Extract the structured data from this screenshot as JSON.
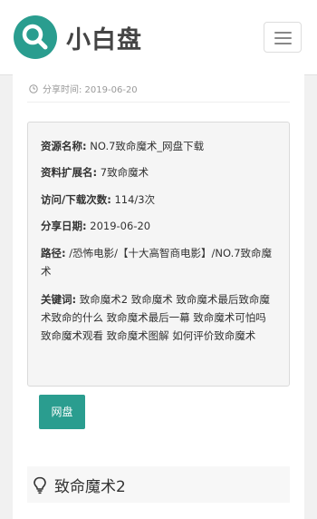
{
  "header": {
    "brand": "小白盘",
    "logo_icon": "search-icon",
    "menu_icon": "hamburger-icon",
    "accent": "#2a9d8f"
  },
  "article": {
    "share_time": "分享时间: 2019-06-20",
    "clock_icon": "clock-icon",
    "info": [
      {
        "label": "资源名称:",
        "value": "NO.7致命魔术_网盘下载"
      },
      {
        "label": "资料扩展名:",
        "value": "7致命魔术"
      },
      {
        "label": "访问/下载次数:",
        "value": "114/3次"
      },
      {
        "label": "分享日期:",
        "value": "2019-06-20"
      },
      {
        "label": "路径:",
        "value": "/恐怖电影/【十大高智商电影】/NO.7致命魔术"
      },
      {
        "label": "关键词:",
        "value": "致命魔术2 致命魔术 致命魔术最后致命魔术致命的什么 致命魔术最后一幕 致命魔术可怕吗 致命魔术观看 致命魔术图解 如何评价致命魔术"
      }
    ],
    "disk_button": "网盘"
  },
  "related": {
    "icon": "lightbulb-icon",
    "title": "致命魔术2"
  }
}
